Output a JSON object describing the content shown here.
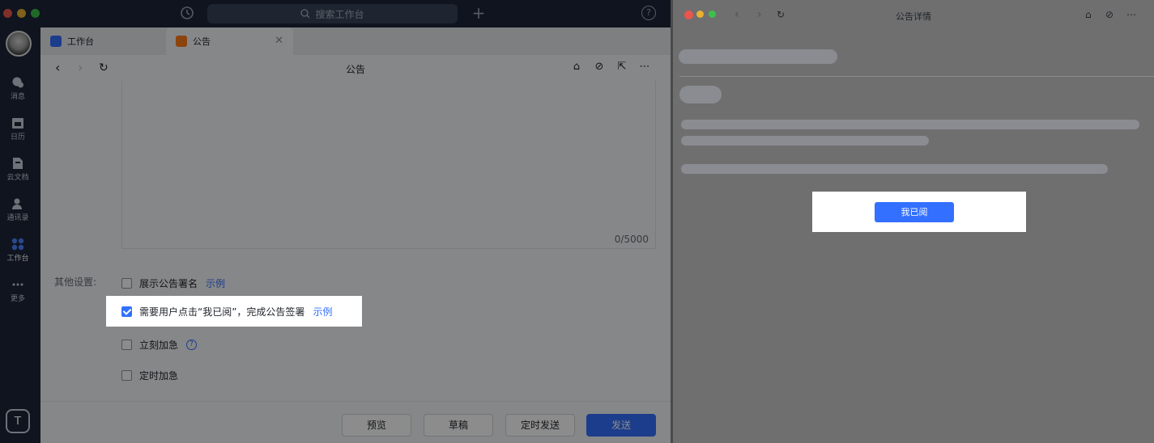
{
  "app": {
    "search_placeholder": "搜索工作台",
    "sidebar": [
      {
        "label": "消息"
      },
      {
        "label": "日历"
      },
      {
        "label": "云文档"
      },
      {
        "label": "通讯录"
      },
      {
        "label": "工作台"
      },
      {
        "label": "更多"
      }
    ],
    "user_initial": "T",
    "tabs": [
      {
        "label": "工作台"
      },
      {
        "label": "公告"
      }
    ],
    "page_title": "公告",
    "editor": {
      "char_count": "0/5000"
    },
    "settings": {
      "label": "其他设置:",
      "options": [
        {
          "label": "展示公告署名",
          "link": "示例",
          "checked": false
        },
        {
          "label": "需要用户点击“我已阅”，完成公告签署",
          "link": "示例",
          "checked": true
        },
        {
          "label": "立刻加急",
          "checked": false
        },
        {
          "label": "定时加急",
          "checked": false
        }
      ]
    },
    "footer": {
      "preview": "预览",
      "draft": "草稿",
      "schedule": "定时发送",
      "send": "发送"
    }
  },
  "detail_window": {
    "title": "公告详情",
    "read_button": "我已阅"
  },
  "colors": {
    "accent": "#3370ff",
    "sidebar_bg": "#1c2538"
  }
}
